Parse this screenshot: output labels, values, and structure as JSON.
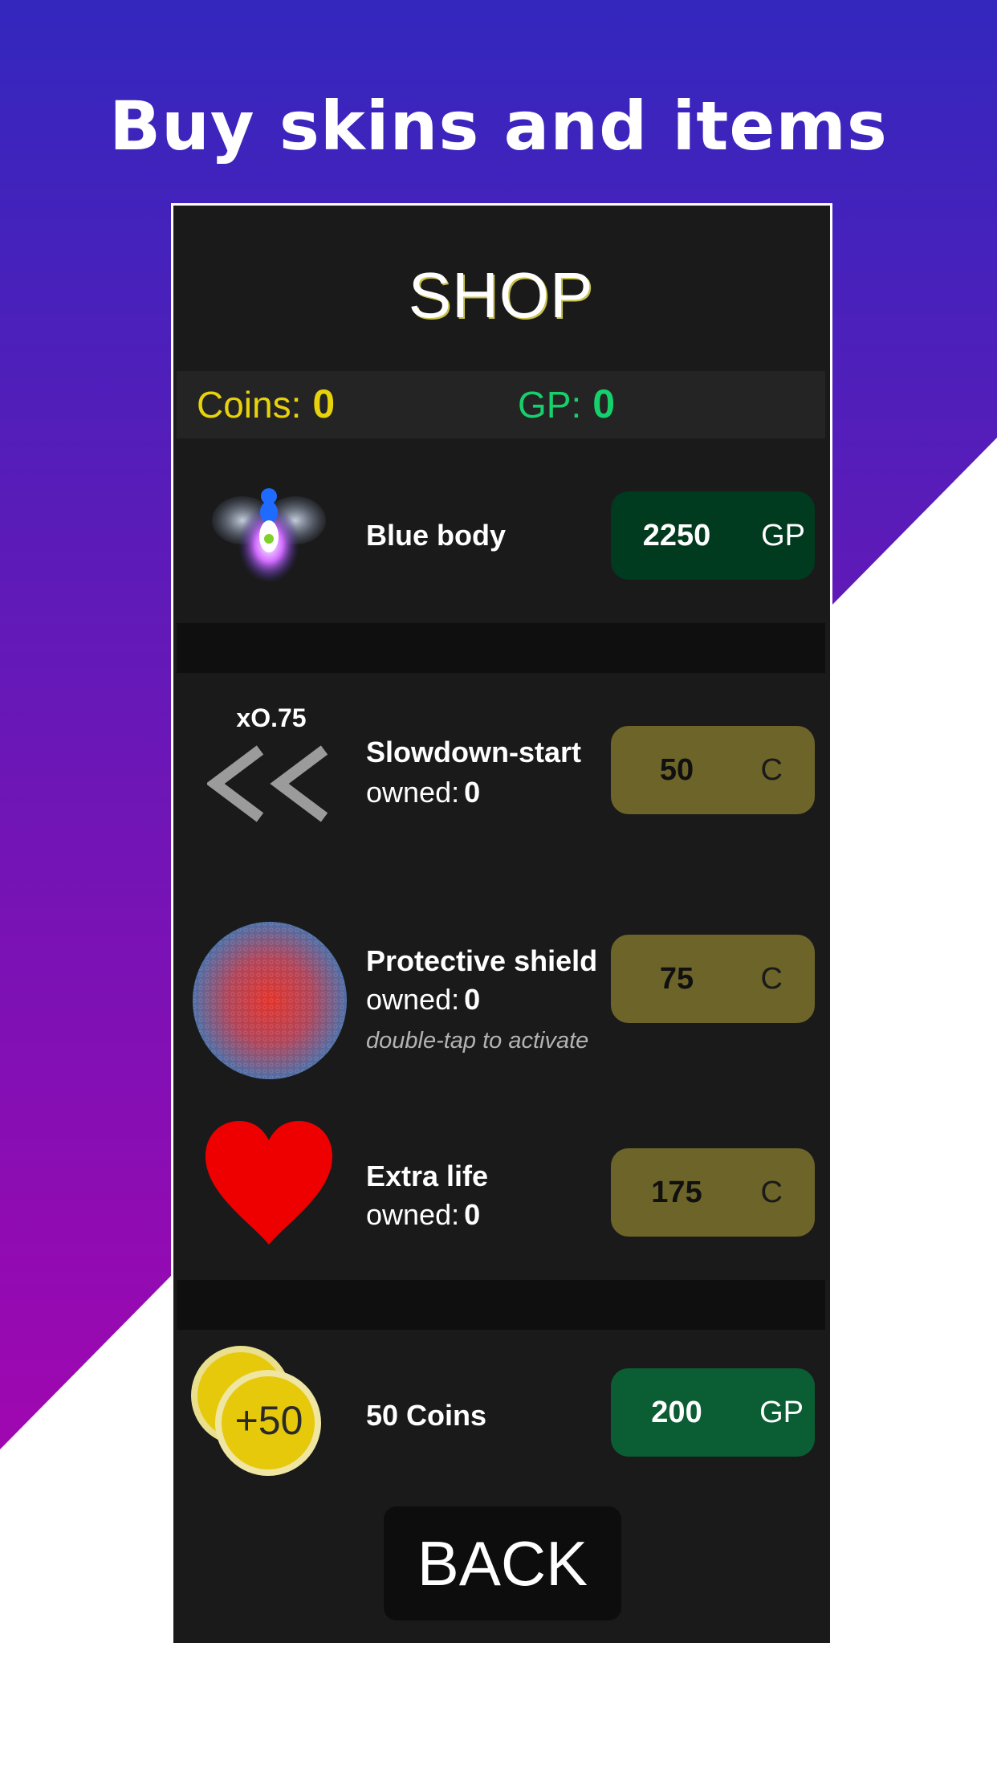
{
  "headline": "Buy skins and items",
  "shop": {
    "title": "SHOP",
    "coins_label": "Coins:",
    "coins_value": "0",
    "gp_label": "GP:",
    "gp_value": "0"
  },
  "items": [
    {
      "name": "Blue body",
      "price": "2250",
      "currency": "GP",
      "icon": "blue-body-bug-icon"
    },
    {
      "name": "Slowdown-start",
      "owned_label": "owned:",
      "owned": "0",
      "multiplier": "xO.75",
      "price": "50",
      "currency": "C",
      "icon": "double-chevron-left-icon"
    },
    {
      "name": "Protective shield",
      "owned_label": "owned:",
      "owned": "0",
      "hint": "double-tap to activate",
      "price": "75",
      "currency": "C",
      "icon": "shield-bubble-icon"
    },
    {
      "name": "Extra life",
      "owned_label": "owned:",
      "owned": "0",
      "price": "175",
      "currency": "C",
      "icon": "heart-icon"
    },
    {
      "name": "50 Coins",
      "badge": "+50",
      "price": "200",
      "currency": "GP",
      "icon": "coins-stack-icon"
    }
  ],
  "back_label": "BACK",
  "colors": {
    "bg_top": "#3327be",
    "bg_bottom": "#a007b0",
    "coins": "#e8d20c",
    "gp": "#16d16b",
    "coin_button": "#6d642a",
    "gp_button_dark": "#003a1f",
    "gp_button": "#0b5d34"
  }
}
